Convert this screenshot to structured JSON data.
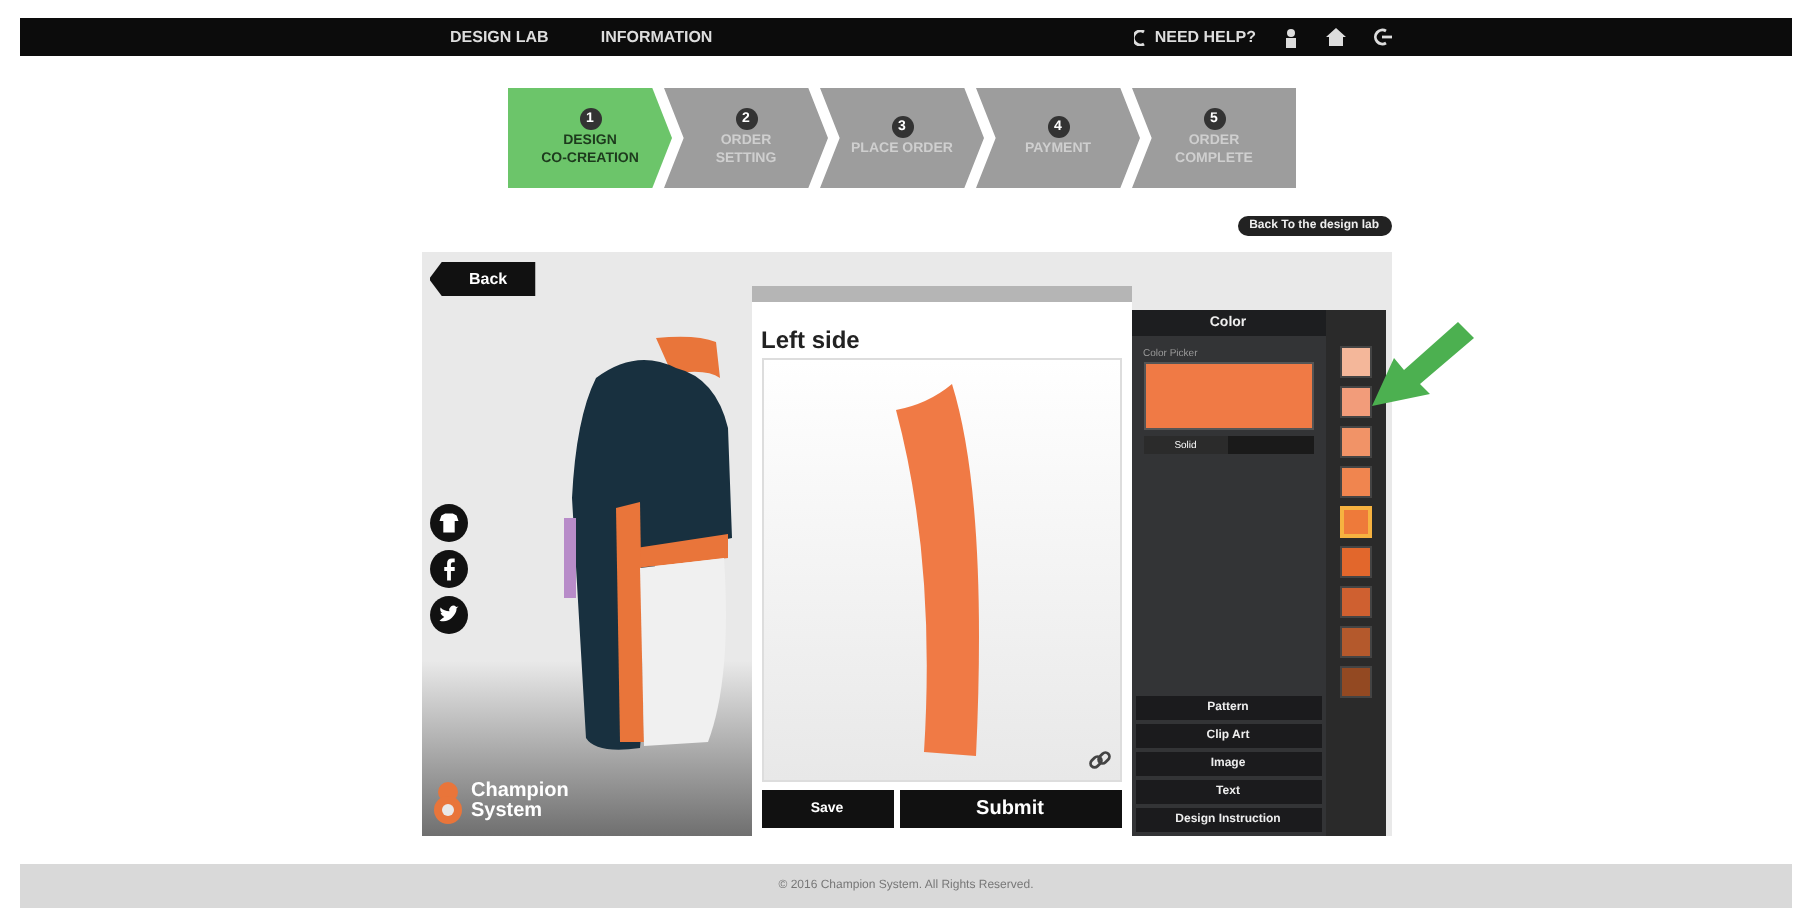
{
  "header": {
    "nav": [
      "DESIGN LAB",
      "INFORMATION"
    ],
    "help": "NEED HELP?"
  },
  "steps": [
    {
      "number": "1",
      "label": "DESIGN\nCO-CREATION",
      "selected": true
    },
    {
      "number": "2",
      "label": "ORDER\nSETTING",
      "selected": false
    },
    {
      "number": "3",
      "label": "PLACE ORDER",
      "selected": false
    },
    {
      "number": "4",
      "label": "PAYMENT",
      "selected": false
    },
    {
      "number": "5",
      "label": "ORDER\nCOMPLETE",
      "selected": false
    }
  ],
  "back_to_lab": "Back To the design lab",
  "back_button": "Back",
  "brand": "Champion\nSystem",
  "editor": {
    "title": "Left side",
    "buttons": [
      "Save",
      "Submit"
    ]
  },
  "color_panel": {
    "title": "Color",
    "color_picker": {
      "label": "Color Picker",
      "color": "#f07a45"
    },
    "fill_types": [
      {
        "label": "Solid",
        "selected": true
      }
    ],
    "sections": [
      "Pattern",
      "Clip Art",
      "Image",
      "Text",
      "Design Instruction"
    ]
  },
  "swatches": [
    {
      "color": "#f4b79a",
      "selected": false
    },
    {
      "color": "#f29c7a",
      "selected": false
    },
    {
      "color": "#f19367",
      "selected": false
    },
    {
      "color": "#f0854f",
      "selected": false
    },
    {
      "color": "#ee7a3a",
      "selected": true
    },
    {
      "color": "#e2672c",
      "selected": false
    },
    {
      "color": "#cf6030",
      "selected": false
    },
    {
      "color": "#b4592c",
      "selected": false
    },
    {
      "color": "#934922",
      "selected": false
    }
  ],
  "footer": "© 2016 Champion System. All Rights Reserved."
}
